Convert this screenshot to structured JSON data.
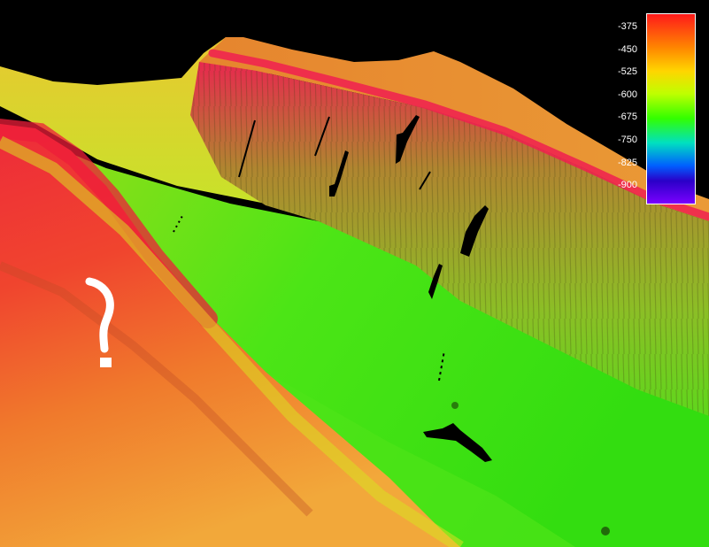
{
  "colors": {
    "sky": "#000000",
    "annotation": "#ffffff",
    "ramp": [
      "#ff1a1a",
      "#ff8800",
      "#ffd500",
      "#bfff00",
      "#33ff00",
      "#00e0c0",
      "#0060ff",
      "#2a00c8",
      "#7a00ff"
    ]
  },
  "color_scale": {
    "ticks": [
      "-375",
      "-450",
      "-525",
      "-600",
      "-675",
      "-750",
      "-825",
      "-900"
    ]
  },
  "annotation": {
    "icon": "question-mark-icon"
  }
}
